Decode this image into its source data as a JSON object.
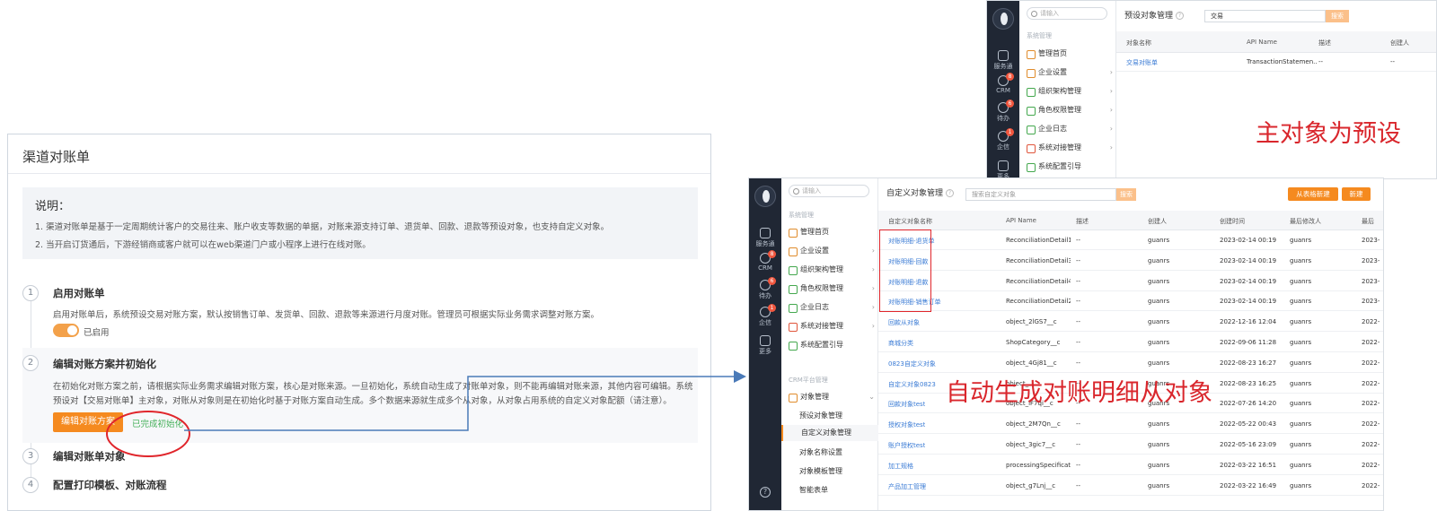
{
  "left_panel": {
    "title": "渠道对账单",
    "desc_heading": "说明：",
    "desc_lines": [
      "1. 渠道对账单是基于一定周期统计客户的交易往来、账户收支等数据的单据，对账来源支持订单、退货单、回款、退款等预设对象，也支持自定义对象。",
      "2. 当开启订货通后，下游经销商或客户就可以在web渠道门户或小程序上进行在线对账。"
    ],
    "steps": [
      {
        "num": "1",
        "title": "启用对账单",
        "desc": "启用对账单后，系统预设交易对账方案，默认按销售订单、发货单、回款、退款等来源进行月度对账。管理员可根据实际业务需求调整对账方案。",
        "toggle_label": "已启用"
      },
      {
        "num": "2",
        "title": "编辑对账方案并初始化",
        "desc_lines": [
          "在初始化对账方案之前，请根据实际业务需求编辑对账方案，核心是对账来源。一旦初始化，系统自动生成了对账单对象，则不能再编辑对账来源，其他内容可编辑。系统",
          "预设对【交易对账单】主对象，对账从对象则是在初始化时基于对账方案自动生成。多个数据来源就生成多个从对象，从对象占用系统的自定义对象配额（请注意）。"
        ],
        "button": "编辑对账方案",
        "status": "已完成初始化"
      },
      {
        "num": "3",
        "title": "编辑对账单对象"
      },
      {
        "num": "4",
        "title": "配置打印模板、对账流程"
      }
    ]
  },
  "dock": {
    "items": [
      "服务通",
      "CRM",
      "待办",
      "企信",
      "更多"
    ],
    "badges": {
      "CRM": "8",
      "待办": "6",
      "企信": "1"
    }
  },
  "top_shot": {
    "search_placeholder": "请输入",
    "menu_group": "系统管理",
    "menu_items": [
      "管理首页",
      "企业设置",
      "组织架构管理",
      "角色权限管理",
      "企业日志",
      "系统对接管理",
      "系统配置引导"
    ],
    "page_title": "预设对象管理",
    "search_value": "交易",
    "search_button": "搜索",
    "columns": [
      "对象名称",
      "API Name",
      "描述",
      "创建人"
    ],
    "rows": [
      [
        "交易对账单",
        "TransactionStatemen...",
        "--",
        "--"
      ]
    ]
  },
  "bottom_shot": {
    "search_placeholder": "请输入",
    "menu_group": "系统管理",
    "menu_items": [
      "管理首页",
      "企业设置",
      "组织架构管理",
      "角色权限管理",
      "企业日志",
      "系统对接管理",
      "系统配置引导"
    ],
    "menu_group2": "CRM平台管理",
    "object_menu": "对象管理",
    "sub_items": [
      "预设对象管理",
      "自定义对象管理",
      "对象名称设置",
      "对象模板管理",
      "智能表单"
    ],
    "selected_sub": "自定义对象管理",
    "page_title": "自定义对象管理",
    "search_placeholder_main": "搜索自定义对象",
    "search_button": "搜索",
    "btn_from_table": "从表格新建",
    "btn_new": "新建",
    "columns": [
      "自定义对象名称",
      "API Name",
      "描述",
      "创建人",
      "创建时间",
      "最后修改人",
      "最后"
    ],
    "rows": [
      [
        "对账明细-退货单",
        "ReconciliationDetail1...",
        "--",
        "guanrs",
        "2023-02-14 00:19",
        "guanrs",
        "2023-"
      ],
      [
        "对账明细-回款",
        "ReconciliationDetail3...",
        "--",
        "guanrs",
        "2023-02-14 00:19",
        "guanrs",
        "2023-"
      ],
      [
        "对账明细-退款",
        "ReconciliationDetail4...",
        "--",
        "guanrs",
        "2023-02-14 00:19",
        "guanrs",
        "2023-"
      ],
      [
        "对账明细-销售订单",
        "ReconciliationDetail2...",
        "--",
        "guanrs",
        "2023-02-14 00:19",
        "guanrs",
        "2023-"
      ],
      [
        "回款从对象",
        "object_2lGS7__c",
        "--",
        "guanrs",
        "2022-12-16 12:04",
        "guanrs",
        "2022-"
      ],
      [
        "商城分类",
        "ShopCategory__c",
        "--",
        "guanrs",
        "2022-09-06 11:28",
        "guanrs",
        "2022-"
      ],
      [
        "0823自定义对象",
        "object_4Gj81__c",
        "--",
        "guanrs",
        "2022-08-23 16:27",
        "guanrs",
        "2022-"
      ],
      [
        "自定义对象0823",
        "object_...",
        "--",
        "guanrs",
        "2022-08-23 16:25",
        "guanrs",
        "2022-"
      ],
      [
        "回款对象test",
        "object_lF7qi__c",
        "--",
        "guanrs",
        "2022-07-26 14:20",
        "guanrs",
        "2022-"
      ],
      [
        "授权对象test",
        "object_2M7Qn__c",
        "--",
        "guanrs",
        "2022-05-22 00:43",
        "guanrs",
        "2022-"
      ],
      [
        "账户授权test",
        "object_3gic7__c",
        "--",
        "guanrs",
        "2022-05-16 23:09",
        "guanrs",
        "2022-"
      ],
      [
        "加工规格",
        "processingSpecificati...",
        "--",
        "guanrs",
        "2022-03-22 16:51",
        "guanrs",
        "2022-"
      ],
      [
        "产品加工管理",
        "object_g7Lnj__c",
        "--",
        "guanrs",
        "2022-03-22 16:49",
        "guanrs",
        "2022-"
      ]
    ]
  },
  "annotations": {
    "top": "主对象为预设",
    "bottom": "自动生成对账明细从对象"
  },
  "help_icon": "?",
  "colors": {
    "accent": "#f58a1f",
    "link": "#3a7bd5",
    "annotation": "#d9262c",
    "arrow": "#4a7ab8",
    "dock": "#202734"
  }
}
